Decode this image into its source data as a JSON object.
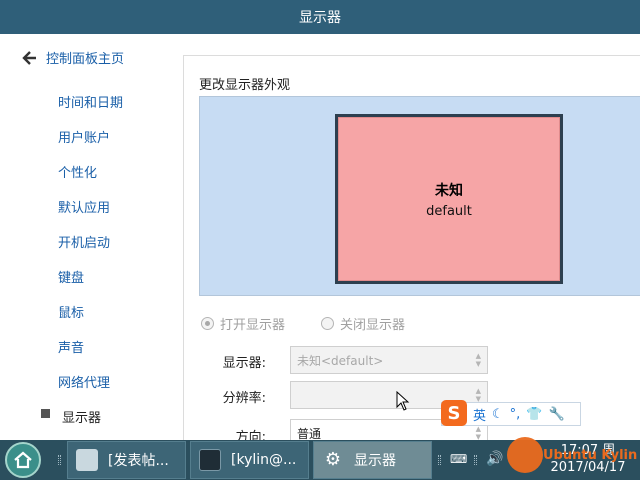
{
  "window": {
    "title": "显示器"
  },
  "sidebar": {
    "back_label": "控制面板主页",
    "items": [
      {
        "label": "时间和日期"
      },
      {
        "label": "用户账户"
      },
      {
        "label": "个性化"
      },
      {
        "label": "默认应用"
      },
      {
        "label": "开机启动"
      },
      {
        "label": "键盘"
      },
      {
        "label": "鼠标"
      },
      {
        "label": "声音"
      },
      {
        "label": "网络代理"
      },
      {
        "label": "显示器",
        "active": true
      }
    ]
  },
  "main": {
    "section_title": "更改显示器外观",
    "monitor": {
      "name": "未知",
      "sub": "default"
    },
    "radio_on": "打开显示器",
    "radio_off": "关闭显示器",
    "display_label": "显示器:",
    "display_value": "未知<default>",
    "resolution_label": "分辨率:",
    "resolution_value": "",
    "orientation_label": "方向:",
    "orientation_value": "普通"
  },
  "ime": {
    "logo": "S",
    "lang": "英",
    "moon_icon": "moon-icon",
    "punct_icon": "punctuation-icon",
    "shirt_icon": "skin-icon",
    "wrench_icon": "wrench-icon"
  },
  "taskbar": {
    "tasks": [
      {
        "label": "[发表帖..."
      },
      {
        "label": "[kylin@..."
      },
      {
        "label": "显示器"
      }
    ],
    "clock_time": "17:07 周",
    "clock_date": "2017/04/17",
    "watermark": "Ubuntu Kylin"
  },
  "colors": {
    "titlebar": "#2f5f79",
    "link": "#1a5fa8",
    "preview_bg": "#c7dcf3",
    "monitor_fill": "#f6a5a6",
    "taskbar": "#2b4f5e"
  }
}
